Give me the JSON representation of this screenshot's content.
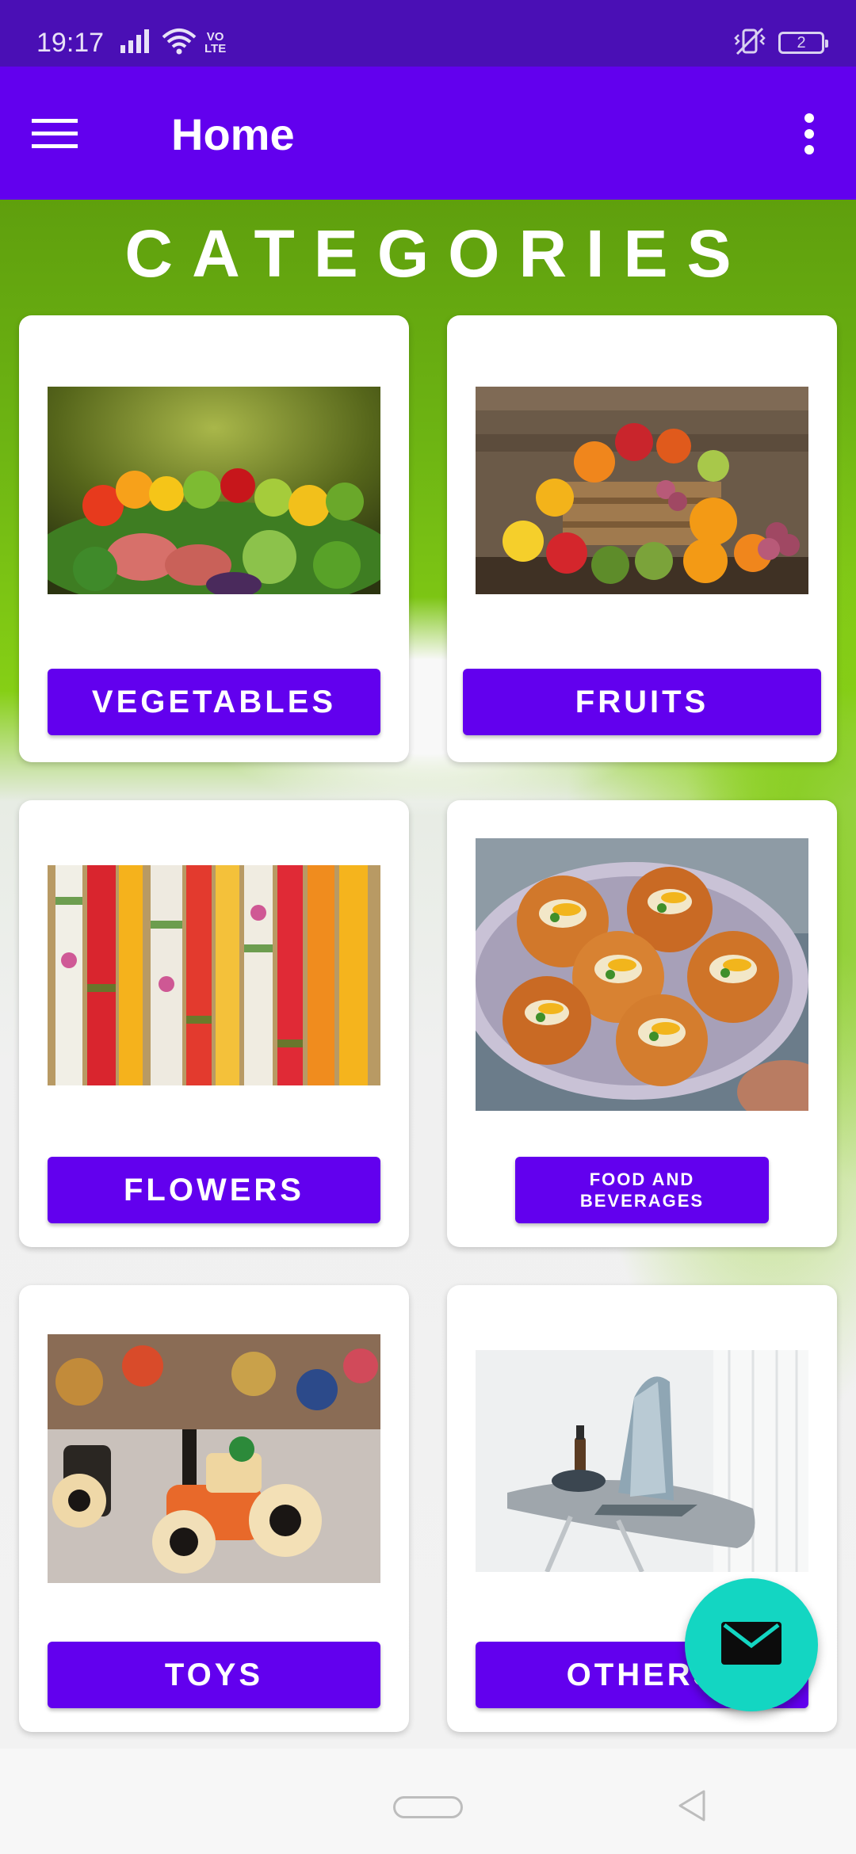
{
  "status_bar": {
    "time": "19:17",
    "network_label": "VO\nLTE",
    "battery_level": "2",
    "icons": [
      "signal-icon",
      "wifi-icon",
      "volte-icon",
      "vibrate-icon",
      "battery-icon"
    ]
  },
  "app_bar": {
    "title": "Home",
    "menu_icon": "hamburger-menu-icon",
    "overflow_icon": "more-vert-icon"
  },
  "heading": "CATEGORIES",
  "categories": [
    {
      "label": "VEGETABLES",
      "image": "vegetables-image"
    },
    {
      "label": "FRUITS",
      "image": "fruits-image"
    },
    {
      "label": "FLOWERS",
      "image": "flowers-image"
    },
    {
      "label": "FOOD AND\nBEVERAGES",
      "image": "food-image"
    },
    {
      "label": "TOYS",
      "image": "toys-image"
    },
    {
      "label": "OTHERS",
      "image": "others-image"
    }
  ],
  "fab": {
    "icon": "mail-icon"
  },
  "colors": {
    "primary": "#6200ee",
    "status_bar": "#4a0fb5",
    "fab": "#13d6c2",
    "background_green": "#6db413"
  }
}
